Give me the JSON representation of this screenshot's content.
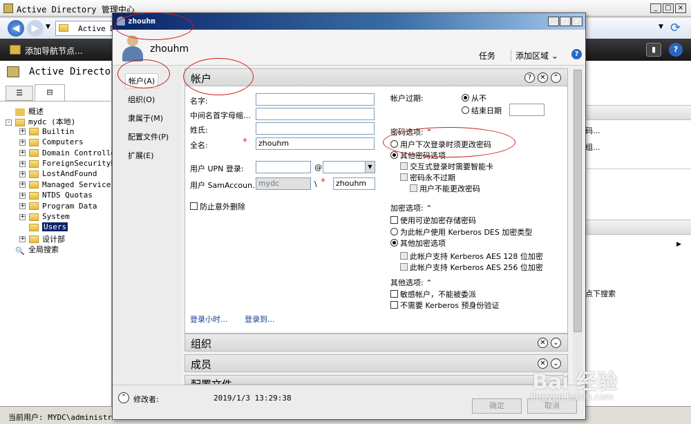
{
  "main_window": {
    "title": "Active Directory 管理中心",
    "address": "Active D",
    "add_nav": "添加导航节点...",
    "left_title": "Active Directo",
    "status": "当前用户: MYDC\\administrato"
  },
  "tree": [
    {
      "label": "概述",
      "indent": 0,
      "expander": "",
      "folder": false
    },
    {
      "label": "mydc (本地)",
      "indent": 0,
      "expander": "-",
      "folder": true
    },
    {
      "label": "Builtin",
      "indent": 1,
      "expander": "+",
      "folder": true
    },
    {
      "label": "Computers",
      "indent": 1,
      "expander": "+",
      "folder": true
    },
    {
      "label": "Domain Controlle",
      "indent": 1,
      "expander": "+",
      "folder": true
    },
    {
      "label": "ForeignSecurityP",
      "indent": 1,
      "expander": "+",
      "folder": true
    },
    {
      "label": "LostAndFound",
      "indent": 1,
      "expander": "+",
      "folder": true
    },
    {
      "label": "Managed Service",
      "indent": 1,
      "expander": "+",
      "folder": true
    },
    {
      "label": "NTDS Quotas",
      "indent": 1,
      "expander": "+",
      "folder": true
    },
    {
      "label": "Program Data",
      "indent": 1,
      "expander": "+",
      "folder": true
    },
    {
      "label": "System",
      "indent": 1,
      "expander": "+",
      "folder": true
    },
    {
      "label": "Users",
      "indent": 1,
      "expander": "",
      "folder": true,
      "selected": true
    },
    {
      "label": "设计部",
      "indent": 1,
      "expander": "+",
      "folder": true
    },
    {
      "label": "全局搜索",
      "indent": 0,
      "expander": "",
      "folder": false
    }
  ],
  "right_pane": {
    "item1": "码...",
    "item2": "组...",
    "item3": "点下搜索"
  },
  "dialog": {
    "title": "zhouhm",
    "user_name": "zhouhm",
    "tasks": "任务",
    "add_sections": "添加区域",
    "nav": [
      "帐户(A)",
      "组织(O)",
      "隶属于(M)",
      "配置文件(P)",
      "扩展(E)"
    ],
    "section_account": "帐户",
    "section_org": "组织",
    "section_members": "成员",
    "section_profile": "配置文件",
    "modified_by": "修改者:",
    "modified_time": "2019/1/3 13:29:38",
    "ok": "确定",
    "cancel": "取消"
  },
  "account": {
    "first_name_label": "名字:",
    "initials_label": "中间名首字母缩…",
    "last_name_label": "姓氏:",
    "full_name_label": "全名:",
    "full_name_value": "zhouhm",
    "upn_label": "用户 UPN 登录:",
    "at": "@",
    "sam_label": "用户 SamAccoun…",
    "sam_domain": "mydc",
    "backslash": "\\",
    "sam_value": "zhouhm",
    "protect_delete": "防止意外删除",
    "logon_hours": "登录小时...",
    "logon_to": "登录到...",
    "expire_label": "帐户过期:",
    "never": "从不",
    "end_date": "结束日期",
    "pwd_options": "密码选项:",
    "must_change": "用户下次登录时须更改密码",
    "other_pwd": "其他密码选项",
    "smartcard": "交互式登录时需要智能卡",
    "never_expire": "密码永不过期",
    "cannot_change": "用户不能更改密码",
    "enc_options": "加密选项:",
    "reversible": "使用可逆加密存储密码",
    "des": "为此帐户使用 Kerberos DES 加密类型",
    "other_enc": "其他加密选项",
    "aes128": "此帐户支持 Kerberos AES 128 位加密",
    "aes256": "此帐户支持 Kerberos AES 256 位加密",
    "other_options": "其他选项:",
    "sensitive": "敏感帐户，不能被委派",
    "no_preauth": "不需要 Kerberos 预身份验证"
  },
  "watermark": {
    "logo": "Bai 经验",
    "url": "jingyan.baidu.com"
  }
}
